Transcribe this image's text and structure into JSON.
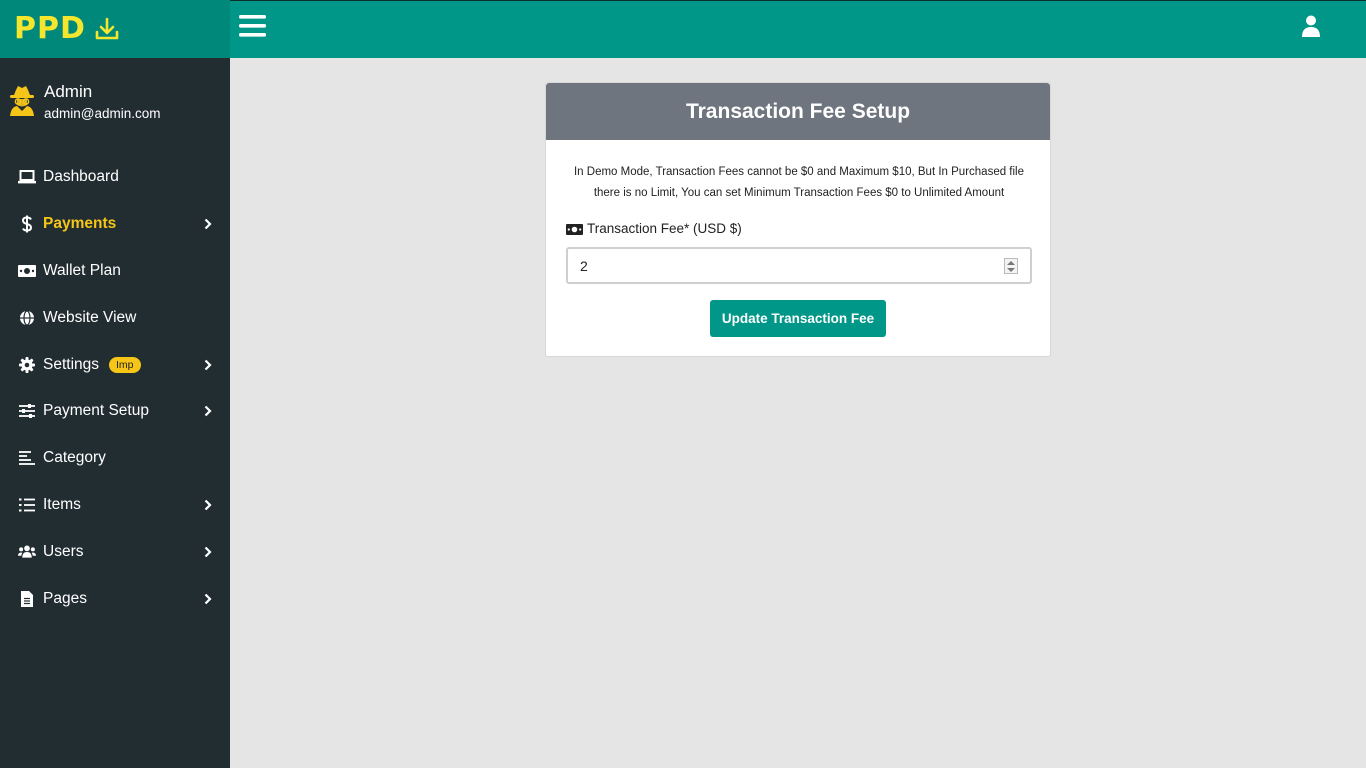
{
  "brand": {
    "logo_text": "PPD",
    "download_icon": "download-icon"
  },
  "user": {
    "name": "Admin",
    "email": "admin@admin.com",
    "avatar_icon": "user-secret-icon"
  },
  "menu": [
    {
      "label": "Dashboard",
      "icon": "laptop-icon"
    },
    {
      "label": "Payments",
      "icon": "dollar-icon",
      "active": true
    },
    {
      "label": "Wallet Plan",
      "icon": "money-bill-icon"
    },
    {
      "label": "Website View",
      "icon": "globe-icon"
    },
    {
      "label": "Settings",
      "icon": "gear-icon",
      "badge": "Imp"
    },
    {
      "label": "Payment Setup",
      "icon": "sliders-icon"
    },
    {
      "label": "Category",
      "icon": "align-left-icon"
    },
    {
      "label": "Items",
      "icon": "list-icon"
    },
    {
      "label": "Users",
      "icon": "users-icon"
    },
    {
      "label": "Pages",
      "icon": "file-icon"
    }
  ],
  "topbar": {
    "menu_icon": "hamburger-icon",
    "user_icon": "user-icon"
  },
  "card": {
    "title": "Transaction Fee Setup",
    "notice": "In Demo Mode, Transaction Fees cannot be $0 and Maximum $10, But In Purchased file there is no Limit, You can set Minimum Transaction Fees $0 to Unlimited Amount",
    "field_label": "Transaction Fee* (USD $)",
    "field_value": "2",
    "button_label": "Update Transaction Fee"
  },
  "colors": {
    "sidebar_bg": "#222d32",
    "topbar_bg": "#009688",
    "brand_bg": "#00897b",
    "accent_yellow": "#f5c518",
    "header_gray": "#6e757e",
    "button_teal": "#009688"
  }
}
